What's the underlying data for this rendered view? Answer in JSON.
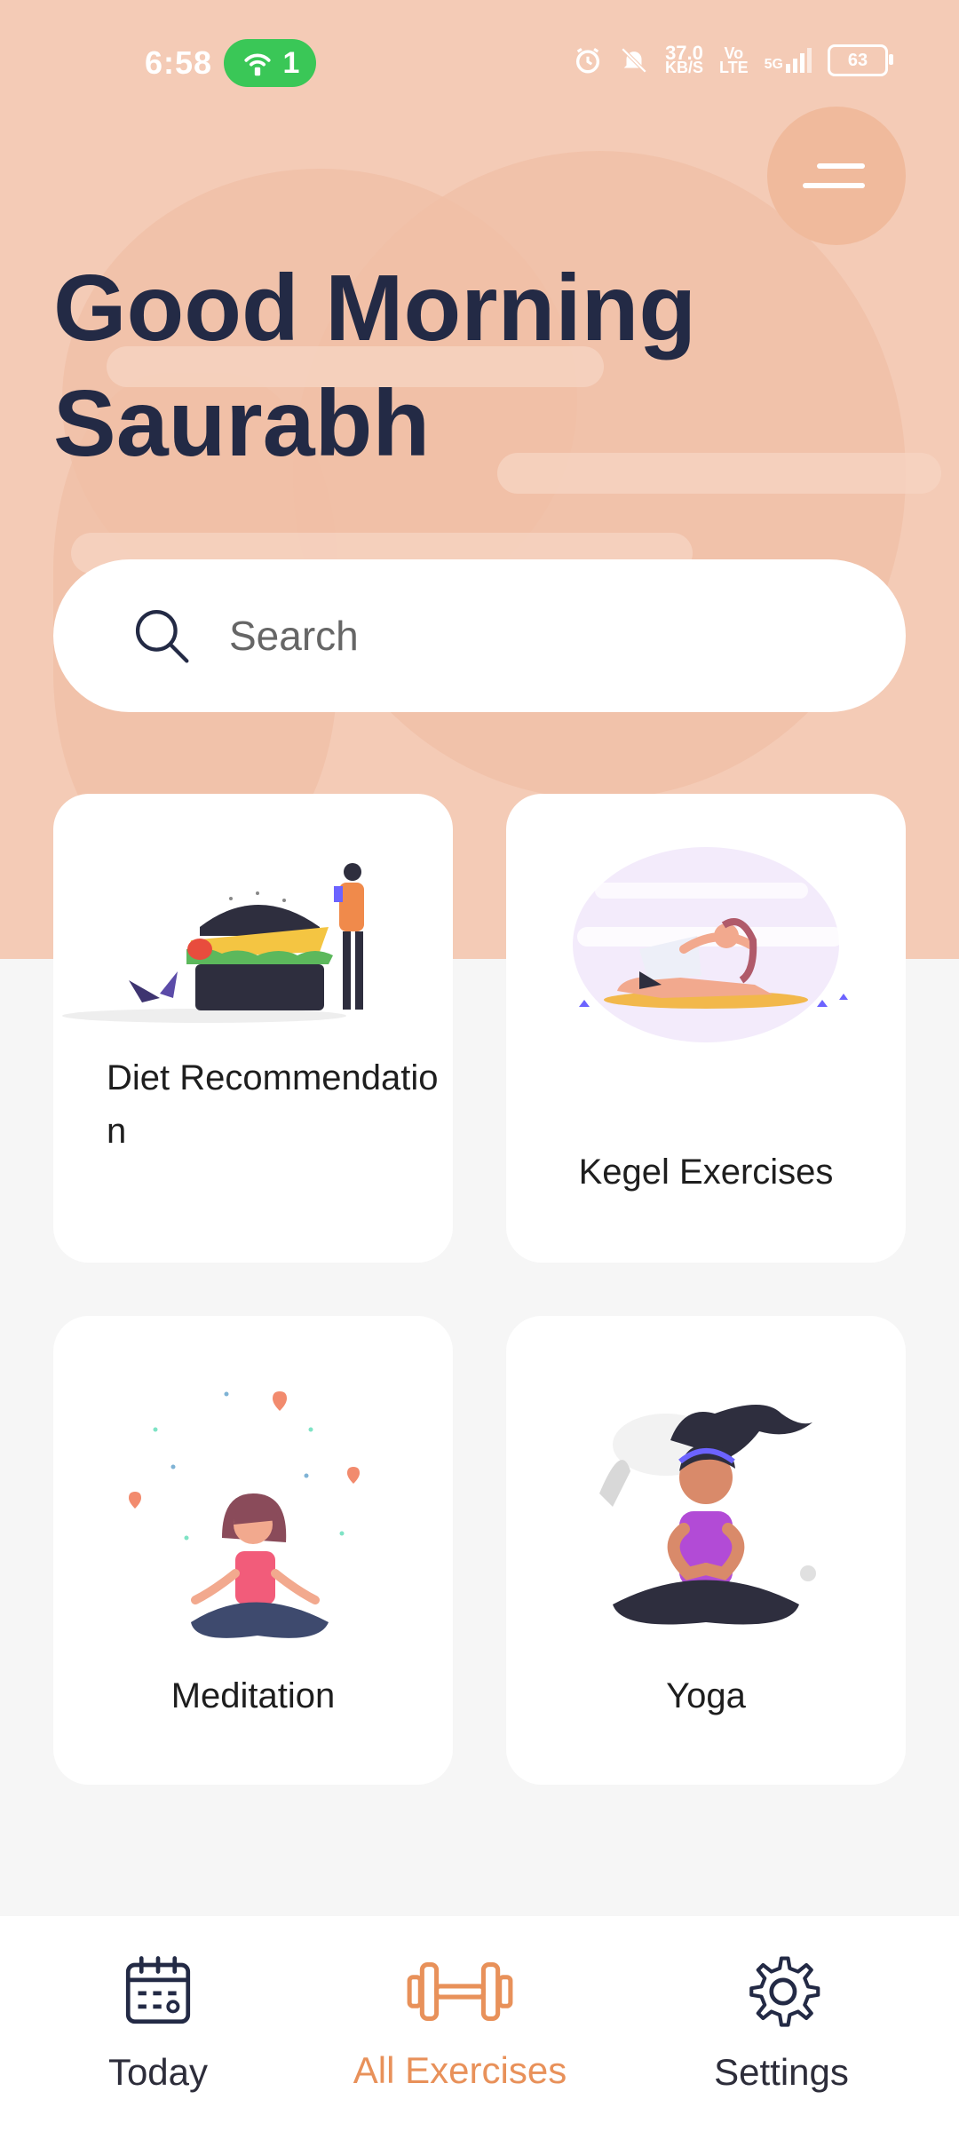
{
  "status_bar": {
    "time": "6:58",
    "hotspot_count": "1",
    "net_speed_value": "37.0",
    "net_speed_unit": "KB/S",
    "volte_top": "Vo",
    "volte_bottom": "LTE",
    "network": "5G",
    "battery": "63",
    "icons": [
      "alarm-icon",
      "mute-icon",
      "signal-icon"
    ]
  },
  "header": {
    "greeting_line1": "Good Morning",
    "greeting_line2": "Saurabh",
    "menu_icon": "hamburger-icon"
  },
  "search": {
    "placeholder": "Search",
    "icon": "search-icon"
  },
  "categories": [
    {
      "label": "Diet Recommendatio\nn",
      "icon": "burger-illustration"
    },
    {
      "label": "Kegel Exercises",
      "icon": "stretching-illustration"
    },
    {
      "label": "Meditation",
      "icon": "meditation-illustration"
    },
    {
      "label": "Yoga",
      "icon": "yoga-illustration"
    }
  ],
  "bottom_nav": {
    "items": [
      {
        "label": "Today",
        "icon": "calendar-icon",
        "active": false
      },
      {
        "label": "All Exercises",
        "icon": "dumbbell-icon",
        "active": true
      },
      {
        "label": "Settings",
        "icon": "gear-icon",
        "active": false
      }
    ]
  },
  "colors": {
    "hero_bg": "#F4CBB6",
    "accent": "#E8915A",
    "title": "#232A45",
    "page_bg": "#F6F6F6"
  }
}
